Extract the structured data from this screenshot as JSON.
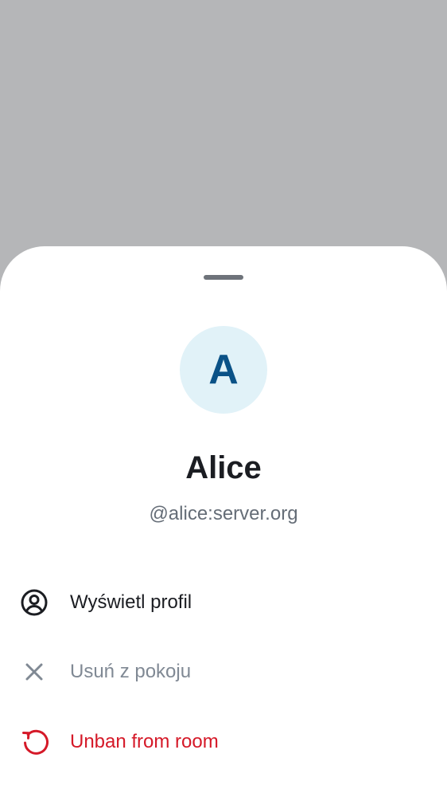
{
  "sheet": {
    "avatar_initial": "A",
    "display_name": "Alice",
    "user_id": "@alice:server.org"
  },
  "actions": [
    {
      "label": "Wyświetl profil",
      "icon": "user-profile-icon",
      "color": "#1b1d22"
    },
    {
      "label": "Usuń z pokoju",
      "icon": "close-icon",
      "color": "#808994",
      "disabled": true
    },
    {
      "label": "Unban from room",
      "icon": "restart-icon",
      "color": "#d51928"
    }
  ],
  "colors": {
    "scrim": "#b5b6b8",
    "avatar_bg": "#e1f2f8",
    "avatar_text": "#0a5287",
    "critical": "#d51928"
  }
}
